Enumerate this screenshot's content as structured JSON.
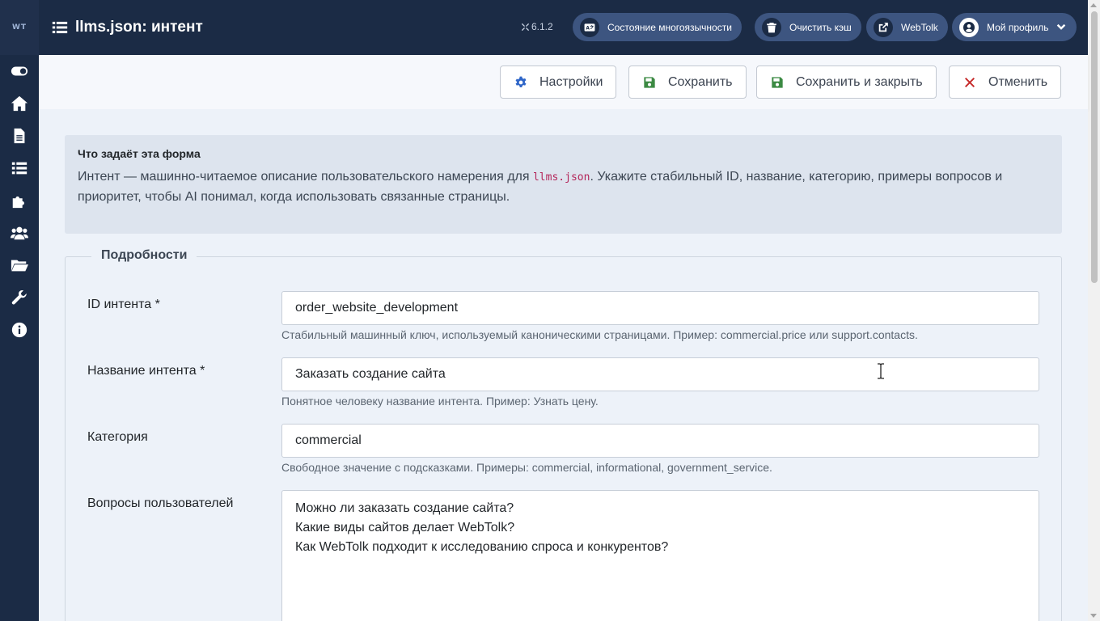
{
  "app": {
    "logo_text": "WT"
  },
  "sidebar": {
    "items": [
      {
        "name": "toggle-icon"
      },
      {
        "name": "home-icon"
      },
      {
        "name": "file-icon"
      },
      {
        "name": "list-icon"
      },
      {
        "name": "puzzle-icon"
      },
      {
        "name": "users-icon"
      },
      {
        "name": "folder-icon"
      },
      {
        "name": "wrench-icon"
      },
      {
        "name": "info-icon"
      }
    ]
  },
  "header": {
    "title": "llms.json: интент",
    "version": "6.1.2",
    "buttons": {
      "multilang": "Состояние многоязычности",
      "clear_cache": "Очистить кэш",
      "site": "WebTolk",
      "profile": "Мой профиль"
    }
  },
  "toolbar": {
    "settings": "Настройки",
    "save": "Сохранить",
    "save_close": "Сохранить и закрыть",
    "cancel": "Отменить"
  },
  "info": {
    "title": "Что задаёт эта форма",
    "text_before": "Интент — машинно-читаемое описание пользовательского намерения для ",
    "code": "llms.json",
    "text_after": ". Укажите стабильный ID, название, категорию, примеры вопросов и приоритет, чтобы AI понимал, когда использовать связанные страницы."
  },
  "form": {
    "legend": "Подробности",
    "intent_id": {
      "label": "ID интента *",
      "value": "order_website_development",
      "help": "Стабильный машинный ключ, используемый каноническими страницами. Пример: commercial.price или support.contacts."
    },
    "intent_name": {
      "label": "Название интента *",
      "value": "Заказать создание сайта",
      "help": "Понятное человеку название интента. Пример: Узнать цену."
    },
    "category": {
      "label": "Категория",
      "value": "commercial",
      "help": "Свободное значение с подсказками. Примеры: commercial, informational, government_service."
    },
    "questions": {
      "label": "Вопросы пользователей",
      "lines": [
        "Можно ли заказать создание сайта?",
        "Какие виды сайтов делает WebTolk?",
        "Как WebTolk подходит к исследованию спроса и конкурентов?"
      ]
    }
  },
  "colors": {
    "sidebar_bg": "#1b2b45",
    "header_button_bg": "#3d5580",
    "settings_icon": "#2f66c8",
    "save_icon": "#3c8a43",
    "cancel_icon": "#c52828"
  }
}
